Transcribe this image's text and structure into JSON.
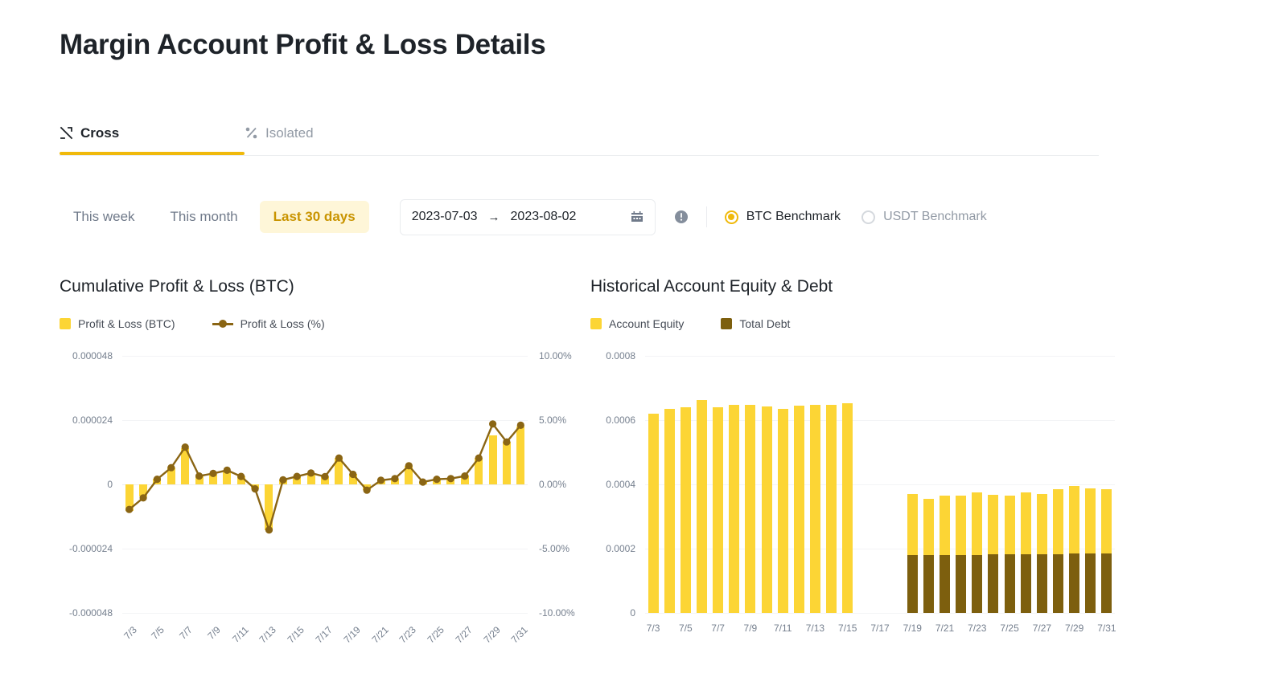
{
  "header": {
    "title": "Margin Account Profit & Loss Details"
  },
  "tabs": [
    {
      "label": "Cross",
      "icon": "cross-arrows-icon",
      "active": true
    },
    {
      "label": "Isolated",
      "icon": "isolated-icon",
      "active": false
    }
  ],
  "filters": {
    "ranges": [
      {
        "label": "This week",
        "active": false
      },
      {
        "label": "This month",
        "active": false
      },
      {
        "label": "Last 30 days",
        "active": true
      }
    ],
    "date_range": {
      "start": "2023-07-03",
      "arrow": "→",
      "end": "2023-08-02",
      "calendar_icon": "calendar-icon"
    },
    "info_icon": "info-circle-icon",
    "benchmarks": [
      {
        "label": "BTC Benchmark",
        "selected": true
      },
      {
        "label": "USDT Benchmark",
        "selected": false
      }
    ]
  },
  "colors": {
    "accent": "#F0B90B",
    "bar_yellow": "#FCD535",
    "debt_brown": "#7D5F0E",
    "line_brown": "#8A6514",
    "active_chip_bg": "#FEF6D8",
    "active_chip_text": "#C99400",
    "text_primary": "#1E2329",
    "text_muted": "#929AA5",
    "axis_text": "#76808F"
  },
  "chart_data": [
    {
      "type": "bar",
      "id": "cumulative-pnl",
      "title": "Cumulative Profit & Loss (BTC)",
      "legend": [
        {
          "name": "Profit & Loss (BTC)",
          "marker": "square",
          "color": "#FCD535"
        },
        {
          "name": "Profit & Loss (%)",
          "marker": "line-dot",
          "color": "#8A6514"
        }
      ],
      "legend_position": "top-left",
      "grid": true,
      "xlabel": "",
      "x": [
        "7/3",
        "7/4",
        "7/5",
        "7/6",
        "7/7",
        "7/8",
        "7/9",
        "7/10",
        "7/11",
        "7/12",
        "7/13",
        "7/14",
        "7/15",
        "7/16",
        "7/17",
        "7/18",
        "7/19",
        "7/20",
        "7/21",
        "7/22",
        "7/23",
        "7/24",
        "7/25",
        "7/26",
        "7/27",
        "7/28",
        "7/29",
        "7/30",
        "7/31"
      ],
      "xtick_labels": [
        "7/3",
        "7/5",
        "7/7",
        "7/9",
        "7/11",
        "7/13",
        "7/15",
        "7/17",
        "7/19",
        "7/21",
        "7/23",
        "7/25",
        "7/27",
        "7/29",
        "7/31"
      ],
      "xtick_rotation": -45,
      "ylabel": "",
      "ylim": [
        -4.8e-05,
        4.8e-05
      ],
      "ytick_labels": [
        "0.000048",
        "0.000024",
        "0",
        "-0.000024",
        "-0.000048"
      ],
      "ytick_values": [
        4.8e-05,
        2.4e-05,
        0,
        -2.4e-05,
        -4.8e-05
      ],
      "y2label": "",
      "y2lim": [
        -10,
        10
      ],
      "y2tick_labels": [
        "10.00%",
        "5.00%",
        "0.00%",
        "-5.00%",
        "-10.00%"
      ],
      "y2tick_values": [
        10,
        5,
        0,
        -5,
        -10
      ],
      "series": [
        {
          "name": "Profit & Loss (BTC)",
          "type": "bar",
          "axis": "left",
          "values": [
            -9.8e-06,
            -4.5e-06,
            2e-06,
            6.2e-06,
            1.35e-05,
            3.2e-06,
            4e-06,
            5.2e-06,
            3e-06,
            -1.5e-06,
            -1.7e-05,
            1.8e-06,
            3e-06,
            4.2e-06,
            3e-06,
            1e-05,
            3.8e-06,
            -2.2e-06,
            1.6e-06,
            2.2e-06,
            7e-06,
            8e-07,
            2e-06,
            2.2e-06,
            3.2e-06,
            1e-05,
            1.82e-05,
            1.6e-05,
            2.15e-05
          ]
        },
        {
          "name": "Profit & Loss (%)",
          "type": "line",
          "axis": "right",
          "values": [
            -1.95,
            -1.05,
            0.4,
            1.3,
            2.9,
            0.65,
            0.85,
            1.1,
            0.62,
            -0.35,
            -3.55,
            0.35,
            0.62,
            0.88,
            0.6,
            2.05,
            0.78,
            -0.45,
            0.32,
            0.45,
            1.45,
            0.18,
            0.4,
            0.45,
            0.65,
            2.05,
            4.7,
            3.3,
            4.6
          ]
        }
      ]
    },
    {
      "type": "bar",
      "id": "equity-debt",
      "title": "Historical Account Equity & Debt",
      "legend": [
        {
          "name": "Account Equity",
          "marker": "square",
          "color": "#FCD535"
        },
        {
          "name": "Total Debt",
          "marker": "square",
          "color": "#7D5F0E"
        }
      ],
      "legend_position": "top-left",
      "grid": true,
      "stacked": true,
      "xlabel": "",
      "x": [
        "7/3",
        "7/4",
        "7/5",
        "7/6",
        "7/7",
        "7/8",
        "7/9",
        "7/10",
        "7/11",
        "7/12",
        "7/13",
        "7/14",
        "7/15",
        "7/16",
        "7/17",
        "7/18",
        "7/19",
        "7/20",
        "7/21",
        "7/22",
        "7/23",
        "7/24",
        "7/25",
        "7/26",
        "7/27",
        "7/28",
        "7/29",
        "7/30",
        "7/31"
      ],
      "xtick_labels": [
        "7/3",
        "7/5",
        "7/7",
        "7/9",
        "7/11",
        "7/13",
        "7/15",
        "7/17",
        "7/19",
        "7/21",
        "7/23",
        "7/25",
        "7/27",
        "7/29",
        "7/31"
      ],
      "xtick_rotation": 0,
      "ylabel": "",
      "ylim": [
        0,
        0.0008
      ],
      "ytick_labels": [
        "0.0008",
        "0.0006",
        "0.0004",
        "0.0002",
        "0"
      ],
      "ytick_values": [
        0.0008,
        0.0006,
        0.0004,
        0.0002,
        0
      ],
      "series": [
        {
          "name": "Total Debt",
          "type": "bar",
          "values": [
            0,
            0,
            0,
            0,
            0,
            0,
            0,
            0,
            0,
            0,
            0,
            0,
            0,
            0,
            0,
            0,
            0.000181,
            0.000181,
            0.000181,
            0.000181,
            0.000181,
            0.000182,
            0.000182,
            0.000183,
            0.000183,
            0.000183,
            0.000184,
            0.000184,
            0.000184
          ]
        },
        {
          "name": "Account Equity",
          "type": "bar",
          "values": [
            0.000621,
            0.000634,
            0.000641,
            0.000662,
            0.000639,
            0.000648,
            0.000647,
            0.000642,
            0.000634,
            0.000645,
            0.000648,
            0.000647,
            0.000653,
            0.0,
            0.0,
            0.0,
            0.000189,
            0.000175,
            0.000184,
            0.000185,
            0.000194,
            0.000185,
            0.000183,
            0.000191,
            0.000187,
            0.000203,
            0.000212,
            0.000203,
            0.000201
          ]
        }
      ]
    }
  ]
}
